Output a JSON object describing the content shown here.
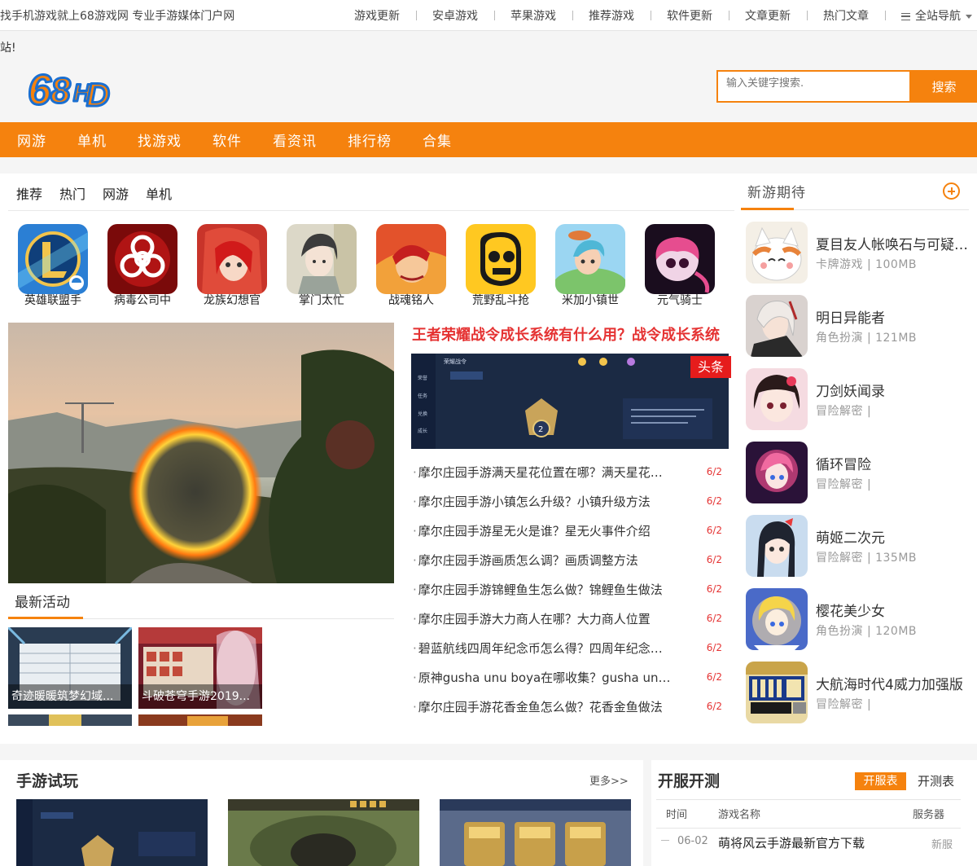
{
  "topbar": {
    "slogan": "找手机游戏就上68游戏网 专业手游媒体门户网",
    "links": [
      "游戏更新",
      "安卓游戏",
      "苹果游戏",
      "推荐游戏",
      "软件更新",
      "文章更新",
      "热门文章"
    ],
    "all_nav": "全站导航"
  },
  "header": {
    "marquee": "站!",
    "logo_text": "68HD",
    "search_placeholder": "输入关键字搜索.",
    "search_button": "搜索"
  },
  "mainnav": [
    "网游",
    "单机",
    "找游戏",
    "软件",
    "看资讯",
    "排行榜",
    "合集"
  ],
  "tabs": [
    "推荐",
    "热门",
    "网游",
    "单机"
  ],
  "games": [
    {
      "name": "英雄联盟手",
      "icon": "lol-icon"
    },
    {
      "name": "病毒公司中",
      "icon": "biohazard-icon"
    },
    {
      "name": "龙族幻想官",
      "icon": "dragon-girl-icon"
    },
    {
      "name": "掌门太忙",
      "icon": "swordsman-icon"
    },
    {
      "name": "战魂铭人",
      "icon": "warrior-icon"
    },
    {
      "name": "荒野乱斗抢",
      "icon": "skull-icon"
    },
    {
      "name": "米加小镇世",
      "icon": "town-icon"
    },
    {
      "name": "元气骑士",
      "icon": "knight-icon"
    }
  ],
  "activities": {
    "title": "最新活动",
    "items": [
      {
        "caption": "奇迹暖暖筑梦幻域..."
      },
      {
        "caption": "斗破苍穹手游2019..."
      }
    ]
  },
  "headline": {
    "title": "王者荣耀战令成长系统有什么用？战令成长系统",
    "badge": "头条"
  },
  "news": [
    {
      "title": "摩尔庄园手游满天星花位置在哪？满天星花在哪里",
      "date": "6/2"
    },
    {
      "title": "摩尔庄园手游小镇怎么升级？小镇升级方法",
      "date": "6/2"
    },
    {
      "title": "摩尔庄园手游星无火是谁？星无火事件介绍",
      "date": "6/2"
    },
    {
      "title": "摩尔庄园手游画质怎么调？画质调整方法",
      "date": "6/2"
    },
    {
      "title": "摩尔庄园手游锦鲤鱼生怎么做？锦鲤鱼生做法",
      "date": "6/2"
    },
    {
      "title": "摩尔庄园手游大力商人在哪？大力商人位置",
      "date": "6/2"
    },
    {
      "title": "碧蓝航线四周年纪念币怎么得？四周年纪念币获取",
      "date": "6/2"
    },
    {
      "title": "原神gusha unu boya在哪收集？gusha unu boya位置",
      "date": "6/2"
    },
    {
      "title": "摩尔庄园手游花香金鱼怎么做？花香金鱼做法",
      "date": "6/2"
    }
  ],
  "upcoming": {
    "title": "新游期待",
    "items": [
      {
        "name": "夏目友人帐唤石与可疑的信使",
        "meta": "卡牌游戏 | 100MB"
      },
      {
        "name": "明日异能者",
        "meta": "角色扮演 | 121MB"
      },
      {
        "name": "刀剑妖闻录",
        "meta": "冒险解密 |"
      },
      {
        "name": "循环冒险",
        "meta": "冒险解密 |"
      },
      {
        "name": "萌姬二次元",
        "meta": "冒险解密 | 135MB"
      },
      {
        "name": "樱花美少女",
        "meta": "角色扮演 | 120MB"
      },
      {
        "name": "大航海时代4威力加强版",
        "meta": "冒险解密 |"
      }
    ]
  },
  "trial": {
    "title": "手游试玩",
    "more": "更多>>"
  },
  "servers": {
    "title": "开服开测",
    "tab_open": "开服表",
    "tab_test": "开测表",
    "headers": [
      "时间",
      "游戏名称",
      "服务器"
    ],
    "rows": [
      {
        "date": "06-02",
        "name": "萌将风云手游最新官方下载",
        "type": "新服"
      }
    ]
  },
  "colors": {
    "accent": "#f5820e",
    "headline": "#e53333"
  }
}
